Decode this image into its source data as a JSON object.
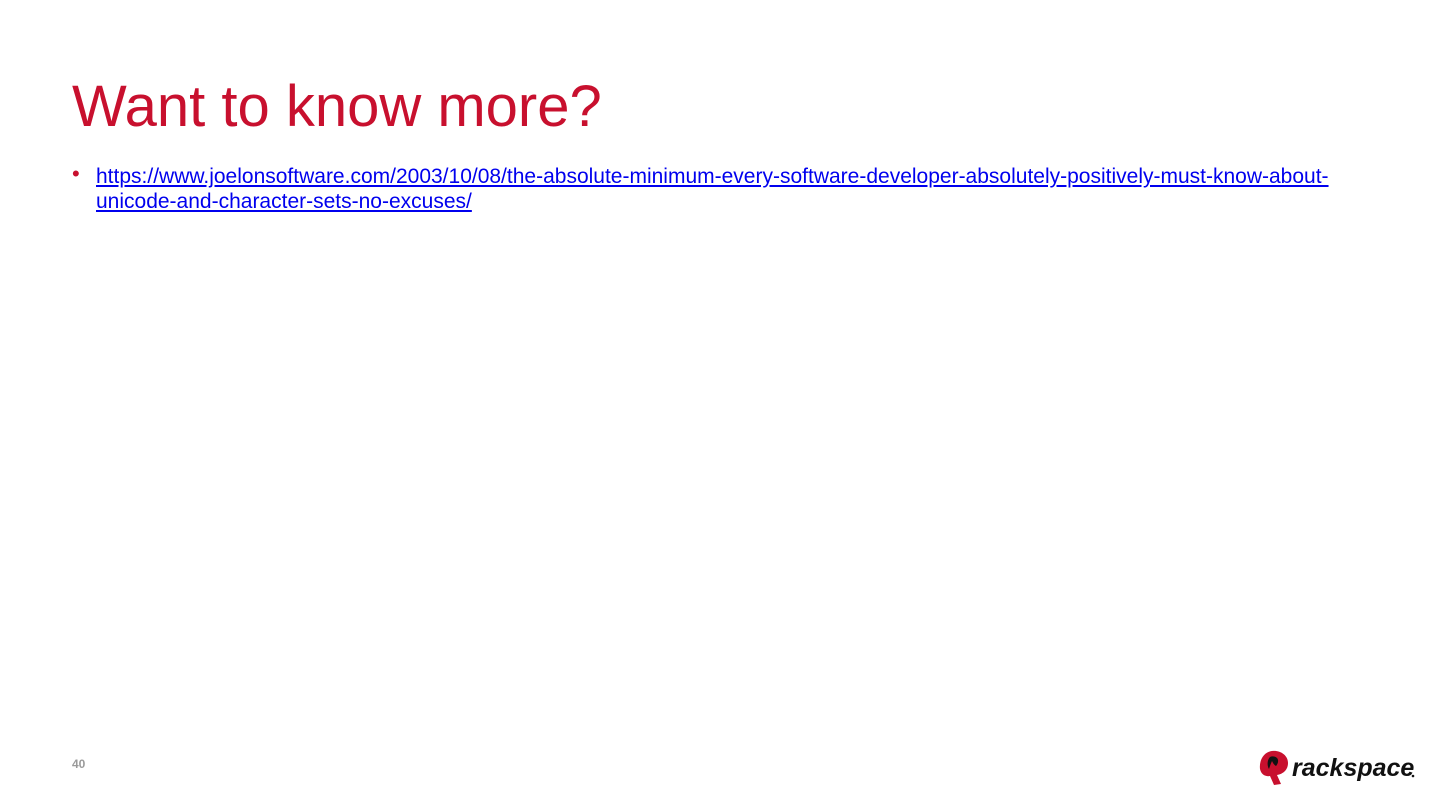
{
  "slide": {
    "title": "Want to know more?",
    "bullets": [
      {
        "link_text": "https://www.joelonsoftware.com/2003/10/08/the-absolute-minimum-every-software-developer-absolutely-positively-must-know-about-unicode-and-character-sets-no-excuses/"
      }
    ],
    "page_number": "40"
  },
  "logo": {
    "wordmark": "rackspace",
    "mark_icon": "rackspace-logo-icon"
  },
  "colors": {
    "title": "#c8102e",
    "bullet": "#c8102e",
    "link": "#0000ee",
    "page_number": "#9a9a9a"
  }
}
